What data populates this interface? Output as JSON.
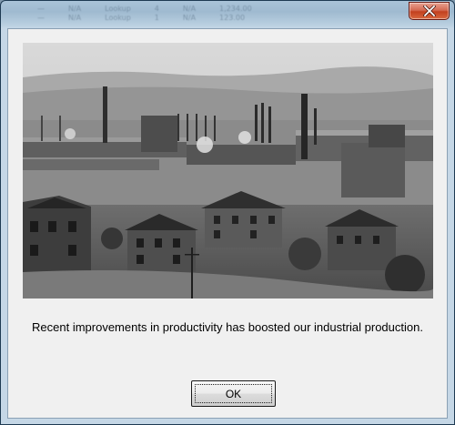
{
  "dialog": {
    "background_rows": [
      [
        "—",
        "N/A",
        "Lookup",
        "4",
        "N/A",
        "1,234.00"
      ],
      [
        "—",
        "N/A",
        "Lookup",
        "1",
        "N/A",
        "123.00"
      ]
    ],
    "close_icon": "close-icon",
    "photo_icon": "industrial-town-photo",
    "message": "Recent improvements in productivity has boosted our industrial production.",
    "ok_label": "OK"
  },
  "colors": {
    "close_button": "#c7452a",
    "client_background": "#f0f0f0"
  }
}
